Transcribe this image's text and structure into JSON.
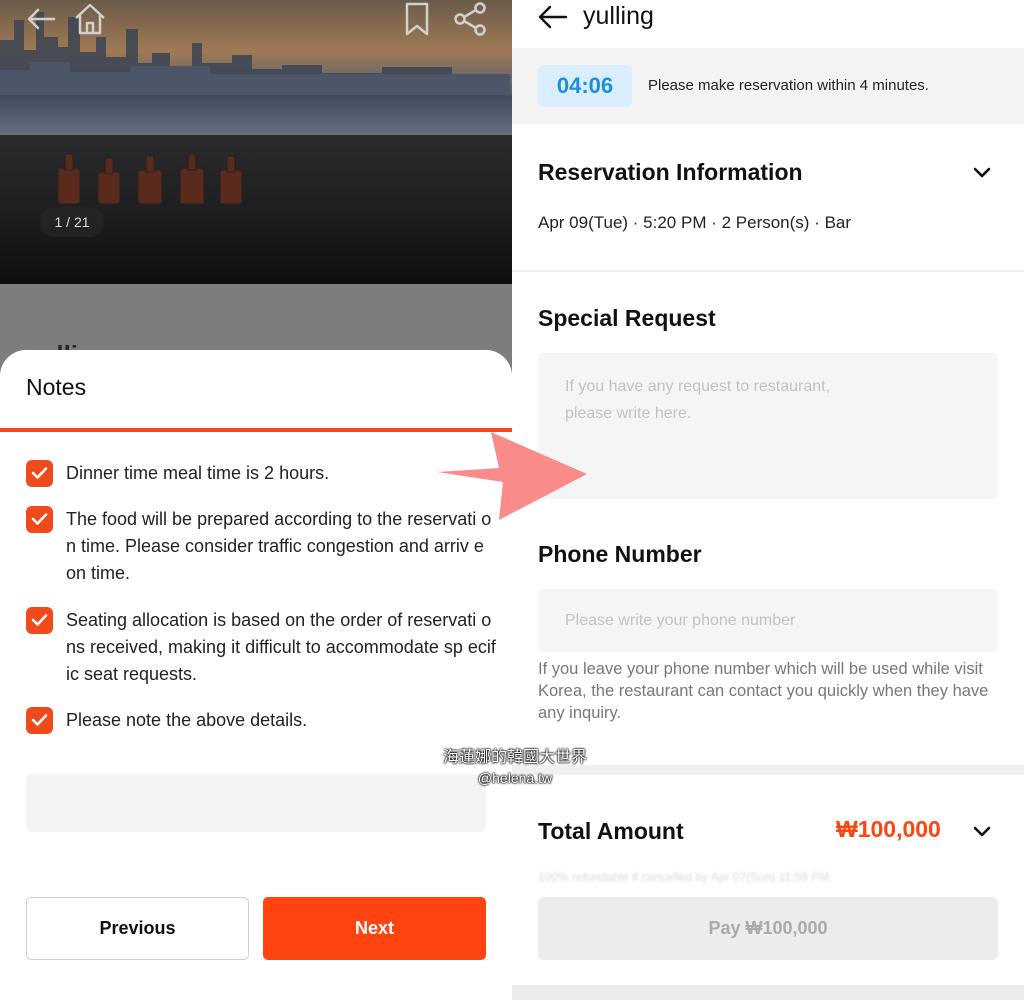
{
  "left": {
    "photo": {
      "counter": "1 / 21"
    },
    "background_title": "yulling",
    "sheet": {
      "title": "Notes",
      "notes": [
        "Dinner time meal time is 2 hours.",
        "The food will be prepared according to the reservati on time. Please consider traffic congestion and arriv e on time.",
        "Seating allocation is based on the order of reservati ons received, making it difficult to accommodate sp ecific seat requests.",
        "Please note the above details."
      ],
      "previous_label": "Previous",
      "next_label": "Next"
    }
  },
  "right": {
    "title": "yulling",
    "timer": {
      "value": "04:06",
      "message": "Please make reservation within 4 minutes."
    },
    "reservation": {
      "title": "Reservation Information",
      "details": "Apr 09(Tue) · 5:20 PM · 2 Person(s) · Bar"
    },
    "special_request": {
      "title": "Special Request",
      "placeholder": "If you have any request to restaurant,\nplease write here."
    },
    "phone": {
      "title": "Phone Number",
      "placeholder": "Please write your phone number",
      "help": "If you leave your phone number which will be used while visit Korea, the restaurant can contact you quickly when they have any inquiry."
    },
    "total": {
      "label": "Total Amount",
      "value": "₩100,000",
      "refund_note": "100% refundable if cancelled by Apr 07(Sun) 11:59 PM."
    },
    "pay_label": "Pay ₩100,000"
  },
  "watermark": {
    "line1": "海蓮娜的韓國大世界",
    "line2": "@helena.tw"
  },
  "colors": {
    "accent": "#ff4411",
    "timer_text": "#1a8fe0",
    "timer_bg": "#dbeefd",
    "arrow": "#f98b8b"
  },
  "icons": [
    "back-arrow-icon",
    "home-icon",
    "bookmark-icon",
    "share-icon",
    "checkbox-check-icon",
    "chevron-down-icon"
  ]
}
